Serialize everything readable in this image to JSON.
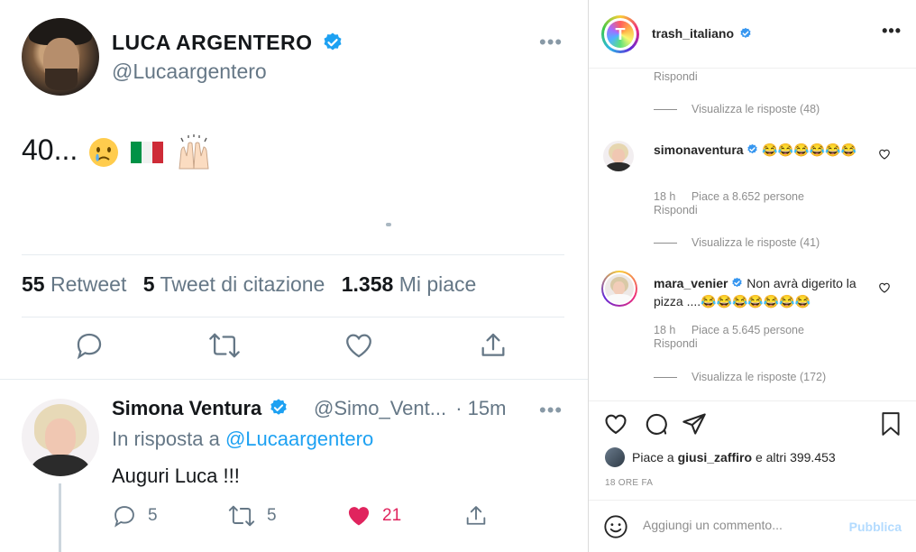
{
  "tweet": {
    "author_name": "LUCA ARGENTERO",
    "author_handle": "@Lucaargentero",
    "text": "40...",
    "emojis": [
      "crying-face",
      "italy-flag",
      "raising-hands"
    ],
    "stats": {
      "retweets_count": "55",
      "retweets_label": "Retweet",
      "quotes_count": "5",
      "quotes_label": "Tweet di citazione",
      "likes_count": "1.358",
      "likes_label": "Mi piace"
    },
    "actions": [
      "reply-icon",
      "retweet-icon",
      "like-icon",
      "share-icon"
    ]
  },
  "reply": {
    "author_name": "Simona Ventura",
    "author_handle": "@Simo_Vent...",
    "time": "· 15m",
    "in_reply_prefix": "In risposta a",
    "in_reply_handle": "@Lucaargentero",
    "text": "Auguri Luca !!!",
    "reply_count": "5",
    "retweet_count": "5",
    "like_count": "21",
    "like_color": "#e0245e"
  },
  "instagram": {
    "username": "trash_italiano",
    "top_reply_label": "Rispondi",
    "top_view_replies": "Visualizza le risposte (48)",
    "comments": [
      {
        "username": "simonaventura",
        "verified": true,
        "text": "😂😂😂😂😂😂",
        "time": "18 h",
        "likes": "Piace a 8.652 persone",
        "reply_label": "Rispondi",
        "view_replies": "Visualizza le risposte (41)"
      },
      {
        "username": "mara_venier",
        "verified": true,
        "text": "Non avrà digerito la pizza ....😂😂😂😂😂😂😂",
        "time": "18 h",
        "likes": "Piace a 5.645 persone",
        "reply_label": "Rispondi",
        "view_replies": "Visualizza le risposte (172)"
      }
    ],
    "likes_prefix": "Piace a",
    "likes_user": "giusi_zaffiro",
    "likes_suffix": "e altri 399.453",
    "post_time": "18 ORE FA",
    "comment_placeholder": "Aggiungi un commento...",
    "publish_label": "Pubblica"
  },
  "colors": {
    "verified_blue": "#1da1f2",
    "instagram_verified": "#3897f0",
    "twitter_link": "#1da1f2",
    "publish_disabled": "#b3dbff"
  }
}
